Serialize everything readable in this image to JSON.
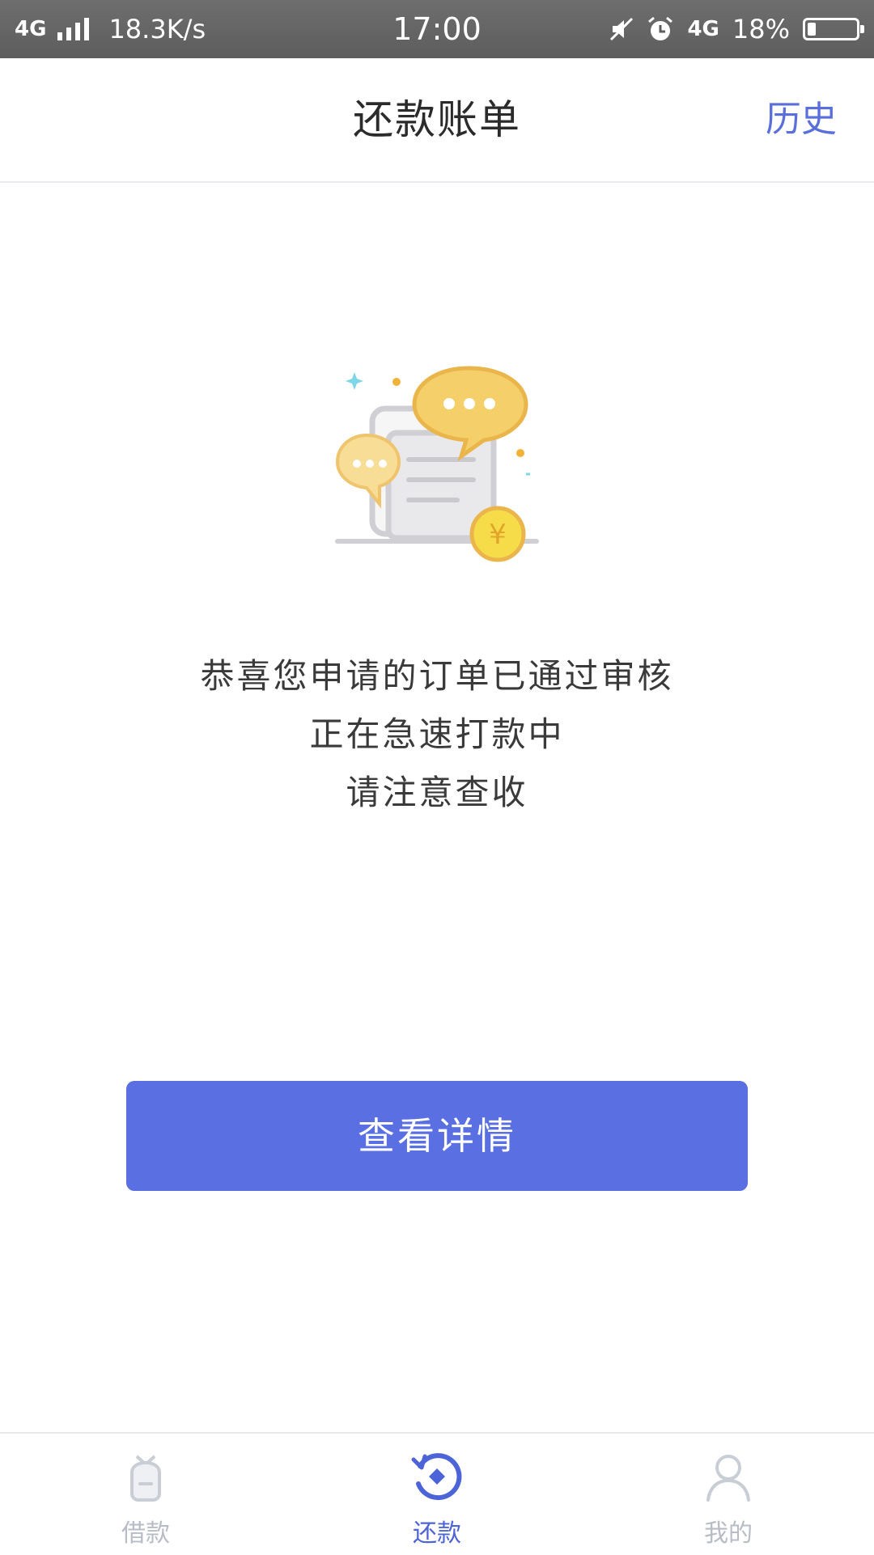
{
  "status_bar": {
    "network": "4G",
    "speed": "18.3K/s",
    "time": "17:00",
    "network2": "4G",
    "battery_percent": "18%",
    "battery_level": 0.18
  },
  "header": {
    "title": "还款账单",
    "history_label": "历史"
  },
  "message": {
    "line1": "恭喜您申请的订单已通过审核",
    "line2": "正在急速打款中",
    "line3": "请注意查收"
  },
  "illustration": {
    "currency_symbol": "¥",
    "accent_color": "#f2c44f"
  },
  "button": {
    "label": "查看详情",
    "color": "#5a6fe1"
  },
  "tabs": [
    {
      "label": "借款",
      "icon": "loan-bag-icon",
      "active": false
    },
    {
      "label": "还款",
      "icon": "repay-cycle-icon",
      "active": true
    },
    {
      "label": "我的",
      "icon": "user-icon",
      "active": false
    }
  ]
}
